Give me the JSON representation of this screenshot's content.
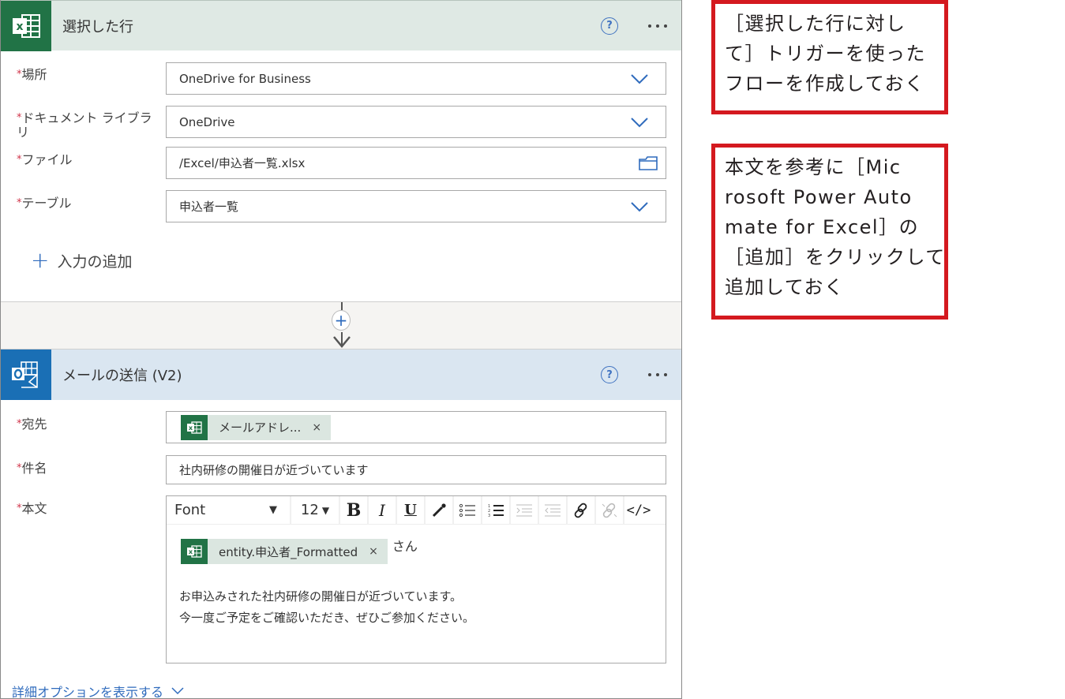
{
  "trigger_card": {
    "title": "選択した行",
    "icon": "excel-icon",
    "help_icon": "?",
    "fields": [
      {
        "label": "場所",
        "required": true,
        "value": "OneDrive for Business",
        "control": "dropdown"
      },
      {
        "label": "ドキュメント ライブラリ",
        "required": true,
        "value": "OneDrive",
        "control": "dropdown"
      },
      {
        "label": "ファイル",
        "required": true,
        "value": "/Excel/申込者一覧.xlsx",
        "control": "file-picker"
      },
      {
        "label": "テーブル",
        "required": true,
        "value": "申込者一覧",
        "control": "dropdown"
      }
    ],
    "add_input_label": "入力の追加",
    "add_input_icon": "+"
  },
  "connector": {
    "insert_icon": "+"
  },
  "action_card": {
    "title": "メールの送信 (V2)",
    "icon": "outlook-icon",
    "help_icon": "?",
    "to": {
      "label": "宛先",
      "required": true,
      "token": "メールアドレ...",
      "token_remove": "×"
    },
    "subject": {
      "label": "件名",
      "required": true,
      "value": "社内研修の開催日が近づいています"
    },
    "body": {
      "label": "本文",
      "required": true,
      "toolbar": {
        "font": "Font",
        "font_arrow": "▼",
        "size": "12",
        "size_arrow": "▼",
        "bold": "B",
        "italic": "I",
        "underline": "U",
        "code": "</>"
      },
      "token": "entity.申込者_Formatted",
      "token_remove": "×",
      "token_suffix": "さん",
      "lines": [
        "お申込みされた社内研修の開催日が近づいています。",
        "今一度ご予定をご確認いただき、ぜひご参加ください。"
      ]
    },
    "advanced_link": "詳細オプションを表示する"
  },
  "required_mark": "*",
  "callouts": [
    {
      "lines": [
        "［選択した行に対し",
        "て］トリガーを使った",
        "フローを作成しておく"
      ]
    },
    {
      "lines": [
        "本文を参考に［Mic",
        "rosoft Power Auto",
        "mate for Excel］の",
        "［追加］をクリックして",
        "追加しておく"
      ]
    }
  ],
  "colors": {
    "excel_green": "#217346",
    "outlook_blue": "#1a6fb5",
    "link_blue": "#2f6bbd",
    "required_red": "#d0344a",
    "callout_red": "#d4191f"
  }
}
